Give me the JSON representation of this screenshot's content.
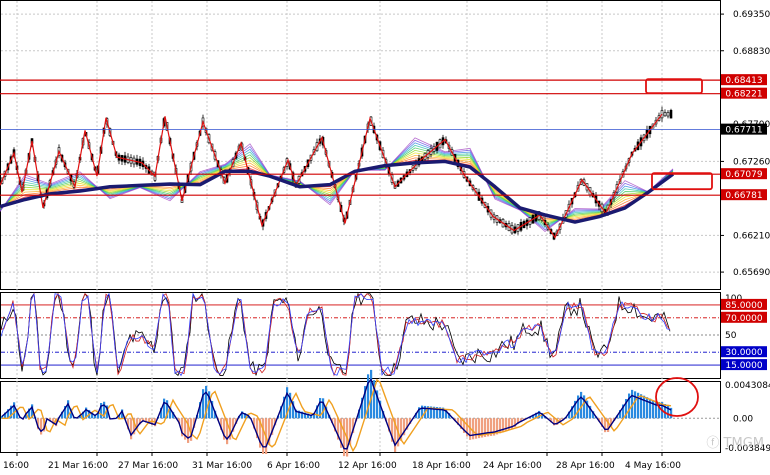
{
  "colors": {
    "grid": "#c8c8c8",
    "candle": "#000000",
    "zigzag": "#e01010",
    "ma_main": "#1a1a70",
    "level_line": "#d00000",
    "current_line": "#3050d0",
    "rsi_black": "#000000",
    "rsi_red": "#d02020",
    "rsi_blue": "#3040ff",
    "hist_pos": "#2a8ae0",
    "hist_neg": "#f0a080",
    "macd_line": "#000080",
    "signal_line": "#f0a020",
    "tag_red": "#d00000",
    "tag_blue": "#0000c8",
    "tag_current": "#000000",
    "annotation": "#e01010"
  },
  "price_axis": {
    "labels": [
      "0.69350",
      "0.68830",
      "0.67260",
      "0.66210",
      "0.65690"
    ],
    "tags": [
      {
        "text": "0.68413",
        "value": 0.68413,
        "style": "red"
      },
      {
        "text": "0.68221",
        "value": 0.68221,
        "style": "red"
      },
      {
        "text": "0.67711",
        "value": 0.67711,
        "style": "current"
      },
      {
        "text": "0.67079",
        "value": 0.67079,
        "style": "red"
      },
      {
        "text": "0.66781",
        "value": 0.66781,
        "style": "red"
      }
    ],
    "partial_label": "0.67700"
  },
  "rsi_axis": {
    "top_label": "100",
    "mid_label": "50",
    "tags": [
      {
        "text": "85.0000",
        "value": 85,
        "style": "red"
      },
      {
        "text": "70.0000",
        "value": 70,
        "style": "red"
      },
      {
        "text": "30.0000",
        "value": 30,
        "style": "blue"
      },
      {
        "text": "15.0000",
        "value": 15,
        "style": "blue"
      }
    ]
  },
  "macd_axis": {
    "top_label": "0.0043084",
    "zero_label": "0.00",
    "bottom_label": "-0.003849"
  },
  "time_axis": {
    "labels": [
      "16:00",
      "21 Mar 16:00",
      "27 Mar 16:00",
      "31 Mar 16:00",
      "6 Apr 16:00",
      "12 Apr 16:00",
      "18 Apr 16:00",
      "24 Apr 16:00",
      "28 Apr 16:00",
      "4 May 16:00"
    ]
  },
  "watermark": "TMGM",
  "chart_data": {
    "type": "candlestick",
    "levels": [
      0.68413,
      0.68221,
      0.67711,
      0.67079,
      0.66781
    ],
    "price_range": [
      0.6545,
      0.6955
    ],
    "zigzag_points": [
      [
        0,
        0.6692
      ],
      [
        14,
        0.6738
      ],
      [
        22,
        0.6682
      ],
      [
        32,
        0.6755
      ],
      [
        43,
        0.666
      ],
      [
        59,
        0.674
      ],
      [
        75,
        0.669
      ],
      [
        85,
        0.677
      ],
      [
        97,
        0.6705
      ],
      [
        106,
        0.6788
      ],
      [
        117,
        0.6732
      ],
      [
        142,
        0.6724
      ],
      [
        155,
        0.6705
      ],
      [
        165,
        0.679
      ],
      [
        182,
        0.667
      ],
      [
        203,
        0.6782
      ],
      [
        225,
        0.6695
      ],
      [
        241,
        0.6752
      ],
      [
        262,
        0.6635
      ],
      [
        288,
        0.6728
      ],
      [
        296,
        0.6692
      ],
      [
        322,
        0.676
      ],
      [
        345,
        0.6638
      ],
      [
        370,
        0.6787
      ],
      [
        395,
        0.669
      ],
      [
        420,
        0.6727
      ],
      [
        445,
        0.6757
      ],
      [
        465,
        0.6705
      ],
      [
        493,
        0.6648
      ],
      [
        514,
        0.6628
      ],
      [
        540,
        0.665
      ],
      [
        555,
        0.6618
      ],
      [
        582,
        0.67
      ],
      [
        606,
        0.6652
      ],
      [
        632,
        0.6737
      ],
      [
        662,
        0.6793
      ]
    ],
    "ma_points": [
      [
        0,
        0.6662
      ],
      [
        25,
        0.6672
      ],
      [
        50,
        0.668
      ],
      [
        80,
        0.6684
      ],
      [
        110,
        0.669
      ],
      [
        140,
        0.6692
      ],
      [
        170,
        0.6694
      ],
      [
        200,
        0.6693
      ],
      [
        225,
        0.6712
      ],
      [
        250,
        0.6712
      ],
      [
        270,
        0.6705
      ],
      [
        300,
        0.669
      ],
      [
        330,
        0.6693
      ],
      [
        355,
        0.6712
      ],
      [
        385,
        0.672
      ],
      [
        415,
        0.6724
      ],
      [
        445,
        0.6726
      ],
      [
        470,
        0.6718
      ],
      [
        495,
        0.669
      ],
      [
        520,
        0.666
      ],
      [
        545,
        0.665
      ],
      [
        575,
        0.664
      ],
      [
        600,
        0.6648
      ],
      [
        625,
        0.666
      ],
      [
        648,
        0.6682
      ],
      [
        673,
        0.6708
      ]
    ],
    "rsi_range": [
      0,
      100
    ],
    "rsi_levels": [
      85,
      70,
      50,
      30,
      15
    ],
    "macd_range": [
      -0.003849,
      0.0043084
    ]
  }
}
